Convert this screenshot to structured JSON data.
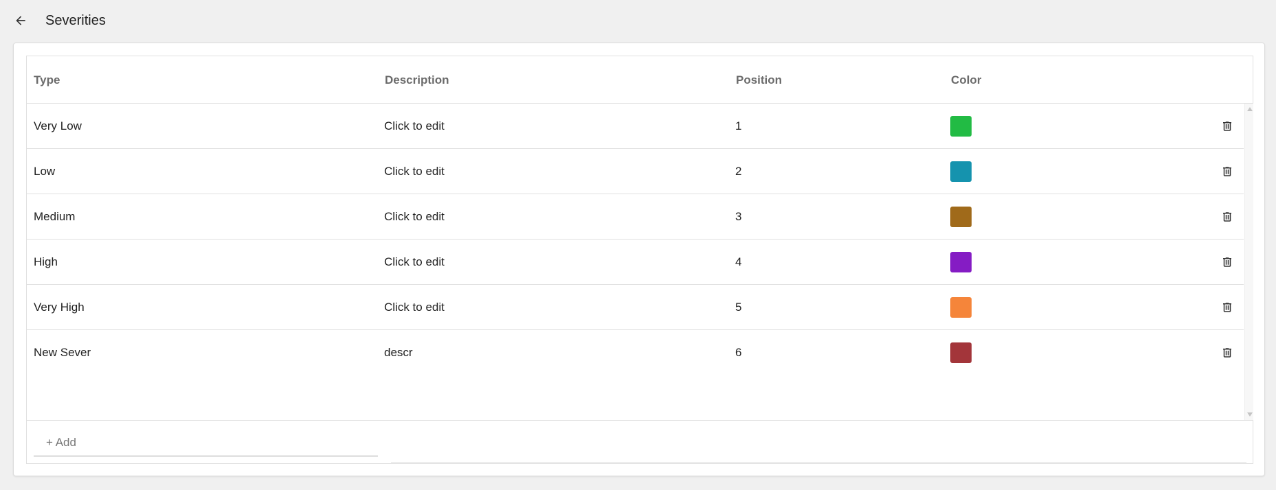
{
  "header": {
    "title": "Severities",
    "back_icon": "arrow-left-icon"
  },
  "table": {
    "columns": [
      "Type",
      "Description",
      "Position",
      "Color"
    ],
    "rows": [
      {
        "type": "Very Low",
        "description": "Click to edit",
        "position": "1",
        "color": "#22bb44"
      },
      {
        "type": "Low",
        "description": "Click to edit",
        "position": "2",
        "color": "#1593ae"
      },
      {
        "type": "Medium",
        "description": "Click to edit",
        "position": "3",
        "color": "#a06a1a"
      },
      {
        "type": "High",
        "description": "Click to edit",
        "position": "4",
        "color": "#851cc4"
      },
      {
        "type": "Very High",
        "description": "Click to edit",
        "position": "5",
        "color": "#f5853a"
      },
      {
        "type": "New Sever",
        "description": "descr",
        "position": "6",
        "color": "#a3353a"
      }
    ],
    "delete_icon": "trash-icon"
  },
  "footer": {
    "add_placeholder": "+ Add"
  }
}
